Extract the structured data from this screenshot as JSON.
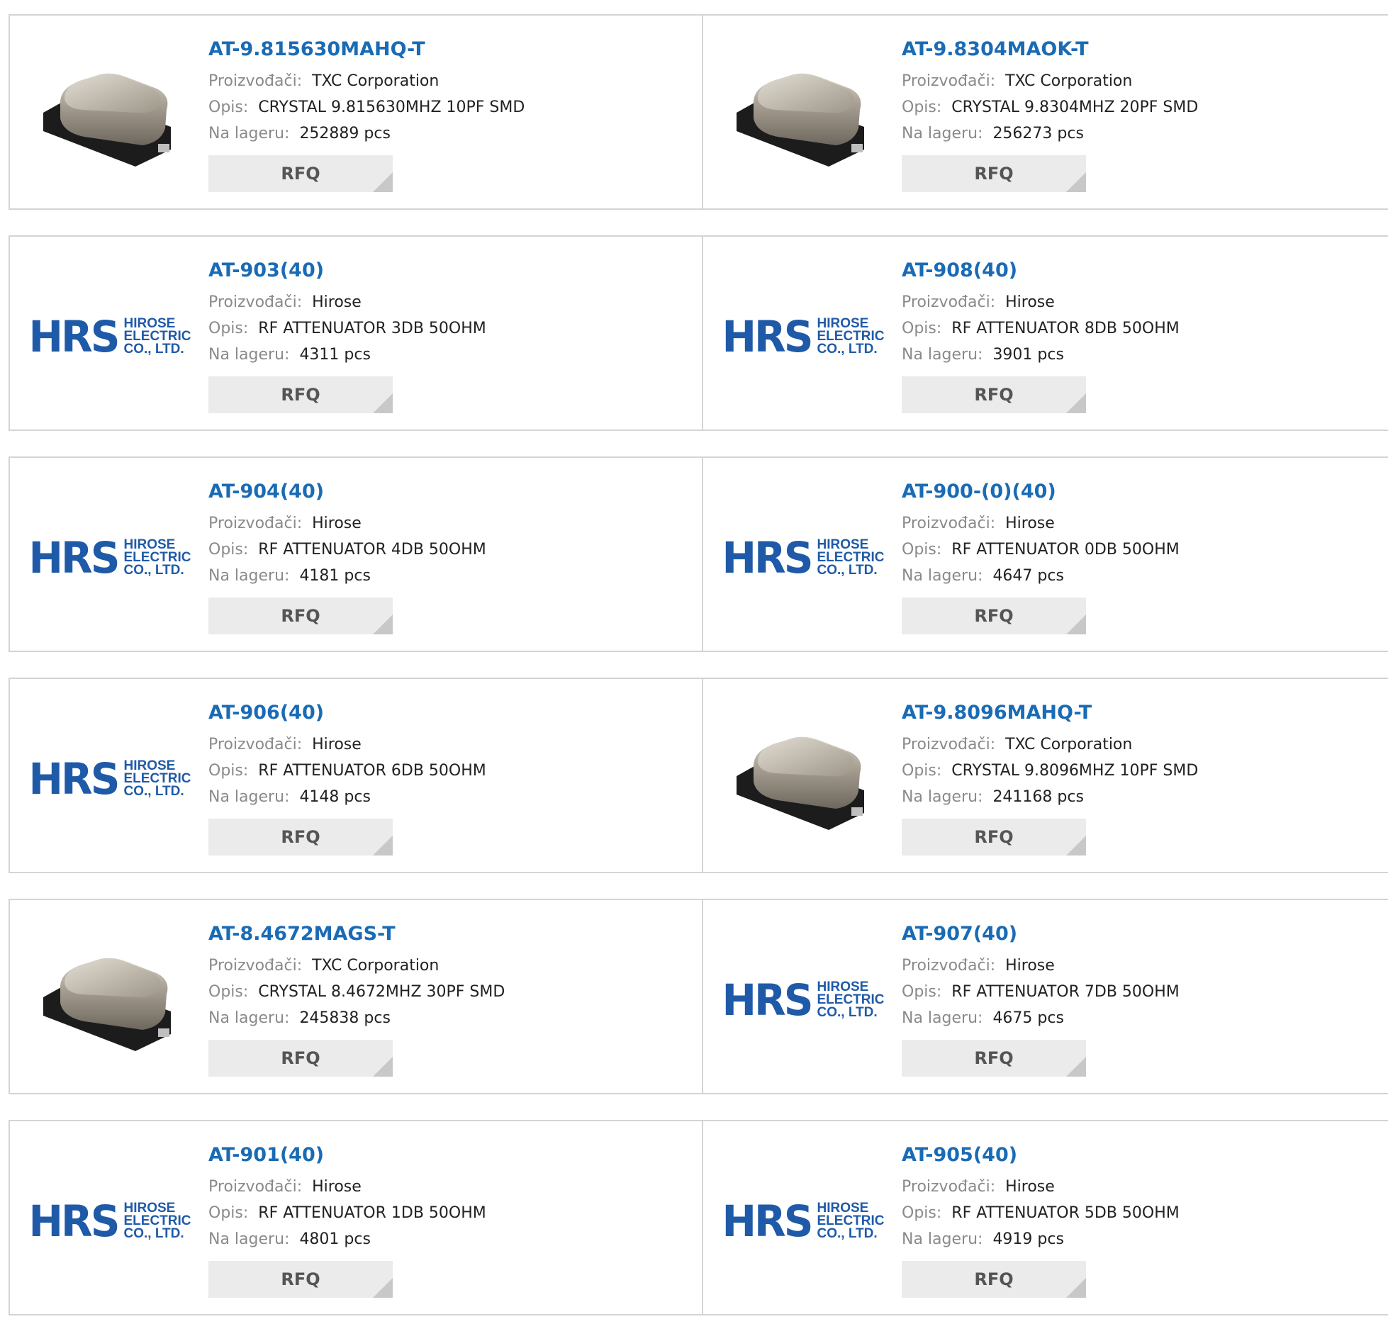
{
  "labels": {
    "manufacturer": "Proizvođači:",
    "description": "Opis:",
    "stock": "Na lageru:",
    "rfq": "RFQ"
  },
  "logo": {
    "mark": "HRS",
    "line1": "HIROSE",
    "line2": "ELECTRIC",
    "line3": "CO., LTD."
  },
  "colors": {
    "part_link": "#1a6bb5",
    "label": "#8a8a8a",
    "button_bg": "#ebebeb",
    "logo": "#1f5aa8"
  },
  "products": [
    {
      "part": "AT-9.815630MAHQ-T",
      "image": "crystal-icon",
      "manufacturer": "TXC Corporation",
      "description": "CRYSTAL 9.815630MHZ 10PF SMD",
      "stock": "252889 pcs"
    },
    {
      "part": "AT-9.8304MAOK-T",
      "image": "crystal-icon",
      "manufacturer": "TXC Corporation",
      "description": "CRYSTAL 9.8304MHZ 20PF SMD",
      "stock": "256273 pcs"
    },
    {
      "part": "AT-903(40)",
      "image": "hirose-logo",
      "manufacturer": "Hirose",
      "description": "RF ATTENUATOR 3DB 50OHM",
      "stock": "4311 pcs"
    },
    {
      "part": "AT-908(40)",
      "image": "hirose-logo",
      "manufacturer": "Hirose",
      "description": "RF ATTENUATOR 8DB 50OHM",
      "stock": "3901 pcs"
    },
    {
      "part": "AT-904(40)",
      "image": "hirose-logo",
      "manufacturer": "Hirose",
      "description": "RF ATTENUATOR 4DB 50OHM",
      "stock": "4181 pcs"
    },
    {
      "part": "AT-900-(0)(40)",
      "image": "hirose-logo",
      "manufacturer": "Hirose",
      "description": "RF ATTENUATOR 0DB 50OHM",
      "stock": "4647 pcs"
    },
    {
      "part": "AT-906(40)",
      "image": "hirose-logo",
      "manufacturer": "Hirose",
      "description": "RF ATTENUATOR 6DB 50OHM",
      "stock": "4148 pcs"
    },
    {
      "part": "AT-9.8096MAHQ-T",
      "image": "crystal-icon",
      "manufacturer": "TXC Corporation",
      "description": "CRYSTAL 9.8096MHZ 10PF SMD",
      "stock": "241168 pcs"
    },
    {
      "part": "AT-8.4672MAGS-T",
      "image": "crystal-icon",
      "manufacturer": "TXC Corporation",
      "description": "CRYSTAL 8.4672MHZ 30PF SMD",
      "stock": "245838 pcs"
    },
    {
      "part": "AT-907(40)",
      "image": "hirose-logo",
      "manufacturer": "Hirose",
      "description": "RF ATTENUATOR 7DB 50OHM",
      "stock": "4675 pcs"
    },
    {
      "part": "AT-901(40)",
      "image": "hirose-logo",
      "manufacturer": "Hirose",
      "description": "RF ATTENUATOR 1DB 50OHM",
      "stock": "4801 pcs"
    },
    {
      "part": "AT-905(40)",
      "image": "hirose-logo",
      "manufacturer": "Hirose",
      "description": "RF ATTENUATOR 5DB 50OHM",
      "stock": "4919 pcs"
    }
  ]
}
